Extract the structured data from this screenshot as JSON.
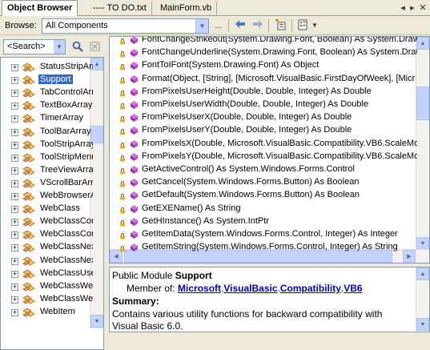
{
  "tabs": [
    {
      "label": "Object Browser",
      "active": true
    },
    {
      "label": "---- TO DO.txt",
      "active": false
    },
    {
      "label": "MainForm.vb",
      "active": false
    }
  ],
  "toolbar": {
    "browse_label": "Browse:",
    "browse_value": "All Components",
    "ellipsis": "..."
  },
  "search": {
    "value": "<Search>"
  },
  "tree": {
    "items": [
      {
        "label": "StatusStripArr",
        "selected": false
      },
      {
        "label": "Support",
        "selected": true
      },
      {
        "label": "TabControlArr",
        "selected": false
      },
      {
        "label": "TextBoxArray",
        "selected": false
      },
      {
        "label": "TimerArray",
        "selected": false
      },
      {
        "label": "ToolBarArray",
        "selected": false
      },
      {
        "label": "ToolStripArray",
        "selected": false
      },
      {
        "label": "ToolStripMenu",
        "selected": false
      },
      {
        "label": "TreeViewArray",
        "selected": false
      },
      {
        "label": "VScrollBarArra",
        "selected": false
      },
      {
        "label": "WebBrowserAr",
        "selected": false
      },
      {
        "label": "WebClass",
        "selected": false
      },
      {
        "label": "WebClassCon",
        "selected": false
      },
      {
        "label": "WebClassCon",
        "selected": false
      },
      {
        "label": "WebClassNex",
        "selected": false
      },
      {
        "label": "WebClassNex",
        "selected": false
      },
      {
        "label": "WebClassUse",
        "selected": false
      },
      {
        "label": "WebClassWeb",
        "selected": false
      },
      {
        "label": "WebClassWeb",
        "selected": false
      },
      {
        "label": "WebItem",
        "selected": false
      }
    ]
  },
  "members": [
    "FontChangeStrikeout(System.Drawing.Font, Boolean) As System.Drawi",
    "FontChangeUnderline(System.Drawing.Font, Boolean) As System.Draw",
    "FontToIFont(System.Drawing.Font) As Object",
    "Format(Object, [String], [Microsoft.VisualBasic.FirstDayOfWeek], [Micr",
    "FromPixelsUserHeight(Double, Double, Integer) As Double",
    "FromPixelsUserWidth(Double, Double, Integer) As Double",
    "FromPixelsUserX(Double, Double, Integer) As Double",
    "FromPixelsUserY(Double, Double, Integer) As Double",
    "FromPixelsX(Double, Microsoft.VisualBasic.Compatibility.VB6.ScaleMode",
    "FromPixelsY(Double, Microsoft.VisualBasic.Compatibility.VB6.ScaleMode",
    "GetActiveControl() As System.Windows.Forms.Control",
    "GetCancel(System.Windows.Forms.Button) As Boolean",
    "GetDefault(System.Windows.Forms.Button) As Boolean",
    "GetEXEName() As String",
    "GetHInstance() As System.IntPtr",
    "GetItemData(System.Windows.Forms.Control, Integer) As Integer",
    "GetItemString(System.Windows.Forms.Control, Integer) As String"
  ],
  "description": {
    "prefix": "Public Module ",
    "name": "Support",
    "member_of_label": "Member of: ",
    "namespace_parts": [
      "Microsoft",
      "VisualBasic",
      "Compatibility",
      "VB6"
    ],
    "summary_label": "Summary:",
    "summary_text": "Contains various utility functions for backward compatibility with Visual Basic 6.0."
  },
  "colors": {
    "selection": "#316ac5",
    "link": "#0000c0",
    "method_icon": "#b040c0",
    "class_icon": "#e8a040"
  }
}
